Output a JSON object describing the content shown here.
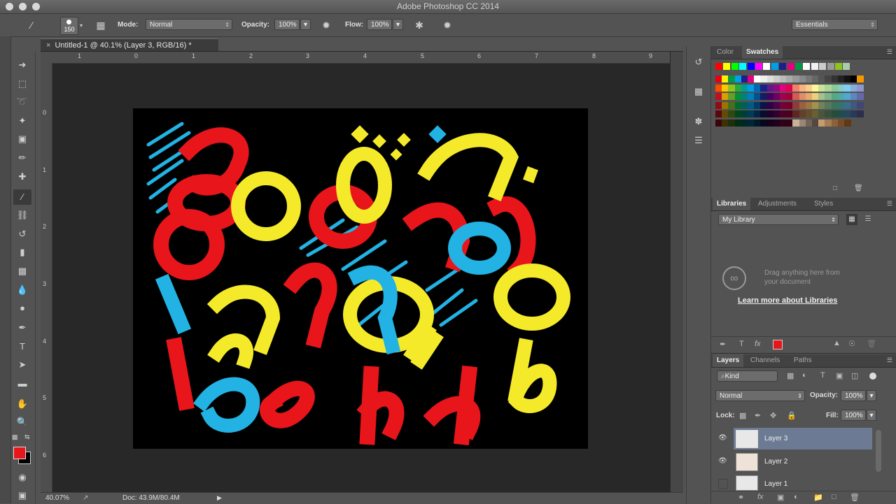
{
  "app": {
    "title": "Adobe Photoshop CC 2014"
  },
  "options_bar": {
    "brush_size": "150",
    "mode_label": "Mode:",
    "mode_value": "Normal",
    "opacity_label": "Opacity:",
    "opacity_value": "100%",
    "flow_label": "Flow:",
    "flow_value": "100%",
    "workspace_value": "Essentials"
  },
  "document": {
    "tab_label": "Untitled-1 @ 40.1% (Layer 3, RGB/16) *",
    "zoom": "40.07%",
    "doc_size": "Doc: 43.9M/80.4M",
    "ruler_h": [
      "1",
      "0",
      "1",
      "2",
      "3",
      "4",
      "5",
      "6",
      "7",
      "8",
      "9"
    ],
    "ruler_v": [
      "0",
      "1",
      "2",
      "3",
      "4",
      "5",
      "6"
    ]
  },
  "color_panel": {
    "tabs": [
      "Color",
      "Swatches"
    ],
    "active_tab": "Swatches",
    "foreground_color": "#e8151b",
    "background_color": "#000000"
  },
  "libraries_panel": {
    "tabs": [
      "Libraries",
      "Adjustments",
      "Styles"
    ],
    "library_select": "My Library",
    "empty_line1": "Drag anything here from",
    "empty_line2": "your document",
    "learn_link": "Learn more about Libraries"
  },
  "layers_panel": {
    "tabs": [
      "Layers",
      "Channels",
      "Paths"
    ],
    "filter_kind": "Kind",
    "blend_mode": "Normal",
    "opacity_label": "Opacity:",
    "opacity_value": "100%",
    "lock_label": "Lock:",
    "fill_label": "Fill:",
    "fill_value": "100%",
    "layers": [
      {
        "name": "Layer 3",
        "selected": true,
        "visible": true
      },
      {
        "name": "Layer 2",
        "selected": false,
        "visible": true
      },
      {
        "name": "Layer 1",
        "selected": false,
        "visible": false
      }
    ]
  },
  "artwork_colors": {
    "red": "#e8151b",
    "yellow": "#f5ea2a",
    "blue": "#22b2e3",
    "canvas": "#000000"
  }
}
